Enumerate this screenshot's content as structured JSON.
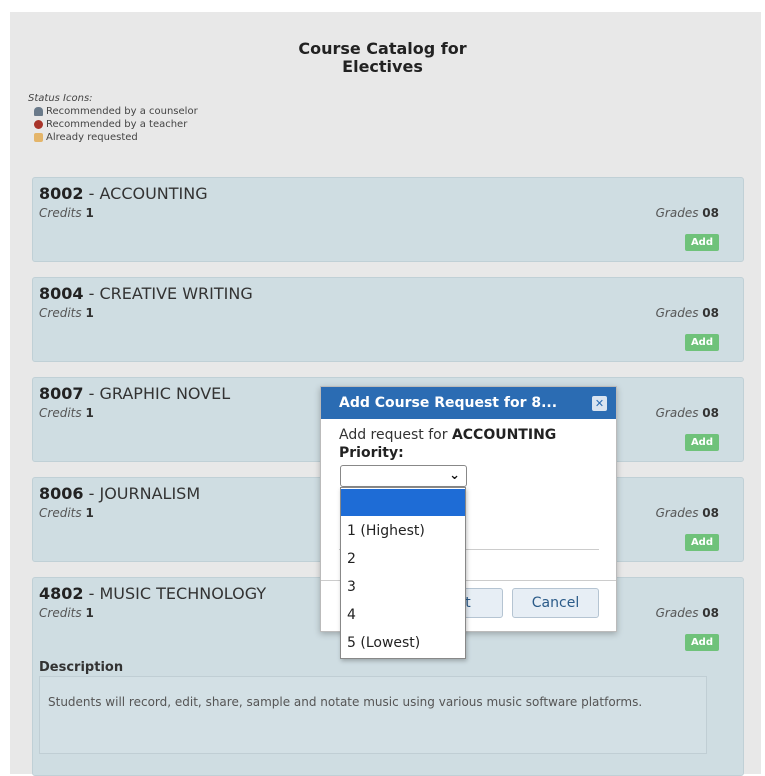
{
  "page": {
    "title_line1": "Course Catalog for",
    "title_line2": "Electives"
  },
  "status_icons": {
    "header": "Status Icons:",
    "items": [
      {
        "icon": "counselor-icon",
        "label": "Recommended by a counselor"
      },
      {
        "icon": "teacher-icon",
        "label": "Recommended by a teacher"
      },
      {
        "icon": "requested-icon",
        "label": "Already requested"
      }
    ]
  },
  "labels": {
    "credits": "Credits",
    "grades": "Grades",
    "add": "Add",
    "description": "Description",
    "sep": " - "
  },
  "courses": [
    {
      "code": "8002",
      "name": "ACCOUNTING",
      "credits": "1",
      "grades": "08"
    },
    {
      "code": "8004",
      "name": "CREATIVE WRITING",
      "credits": "1",
      "grades": "08"
    },
    {
      "code": "8007",
      "name": "GRAPHIC NOVEL",
      "credits": "1",
      "grades": "08"
    },
    {
      "code": "8006",
      "name": "JOURNALISM",
      "credits": "1",
      "grades": "08"
    },
    {
      "code": "4802",
      "name": "MUSIC TECHNOLOGY",
      "credits": "1",
      "grades": "08",
      "description": "Students will record, edit, share, sample and notate music using various music software platforms."
    }
  ],
  "dialog": {
    "title": "Add Course Request for 8...",
    "text_prefix": "Add request for",
    "course_name": "ACCOUNTING",
    "priority_label": "Priority:",
    "selected_value": "",
    "request_button": "est",
    "cancel_button": "Cancel"
  },
  "dropdown": {
    "options": [
      "",
      "1 (Highest)",
      "2",
      "3",
      "4",
      "5 (Lowest)"
    ]
  },
  "colors": {
    "header_blue": "#2b6cb3",
    "card_bg": "#cfdde2",
    "add_green": "#6fc27a",
    "selected_option": "#1e6cd6"
  }
}
